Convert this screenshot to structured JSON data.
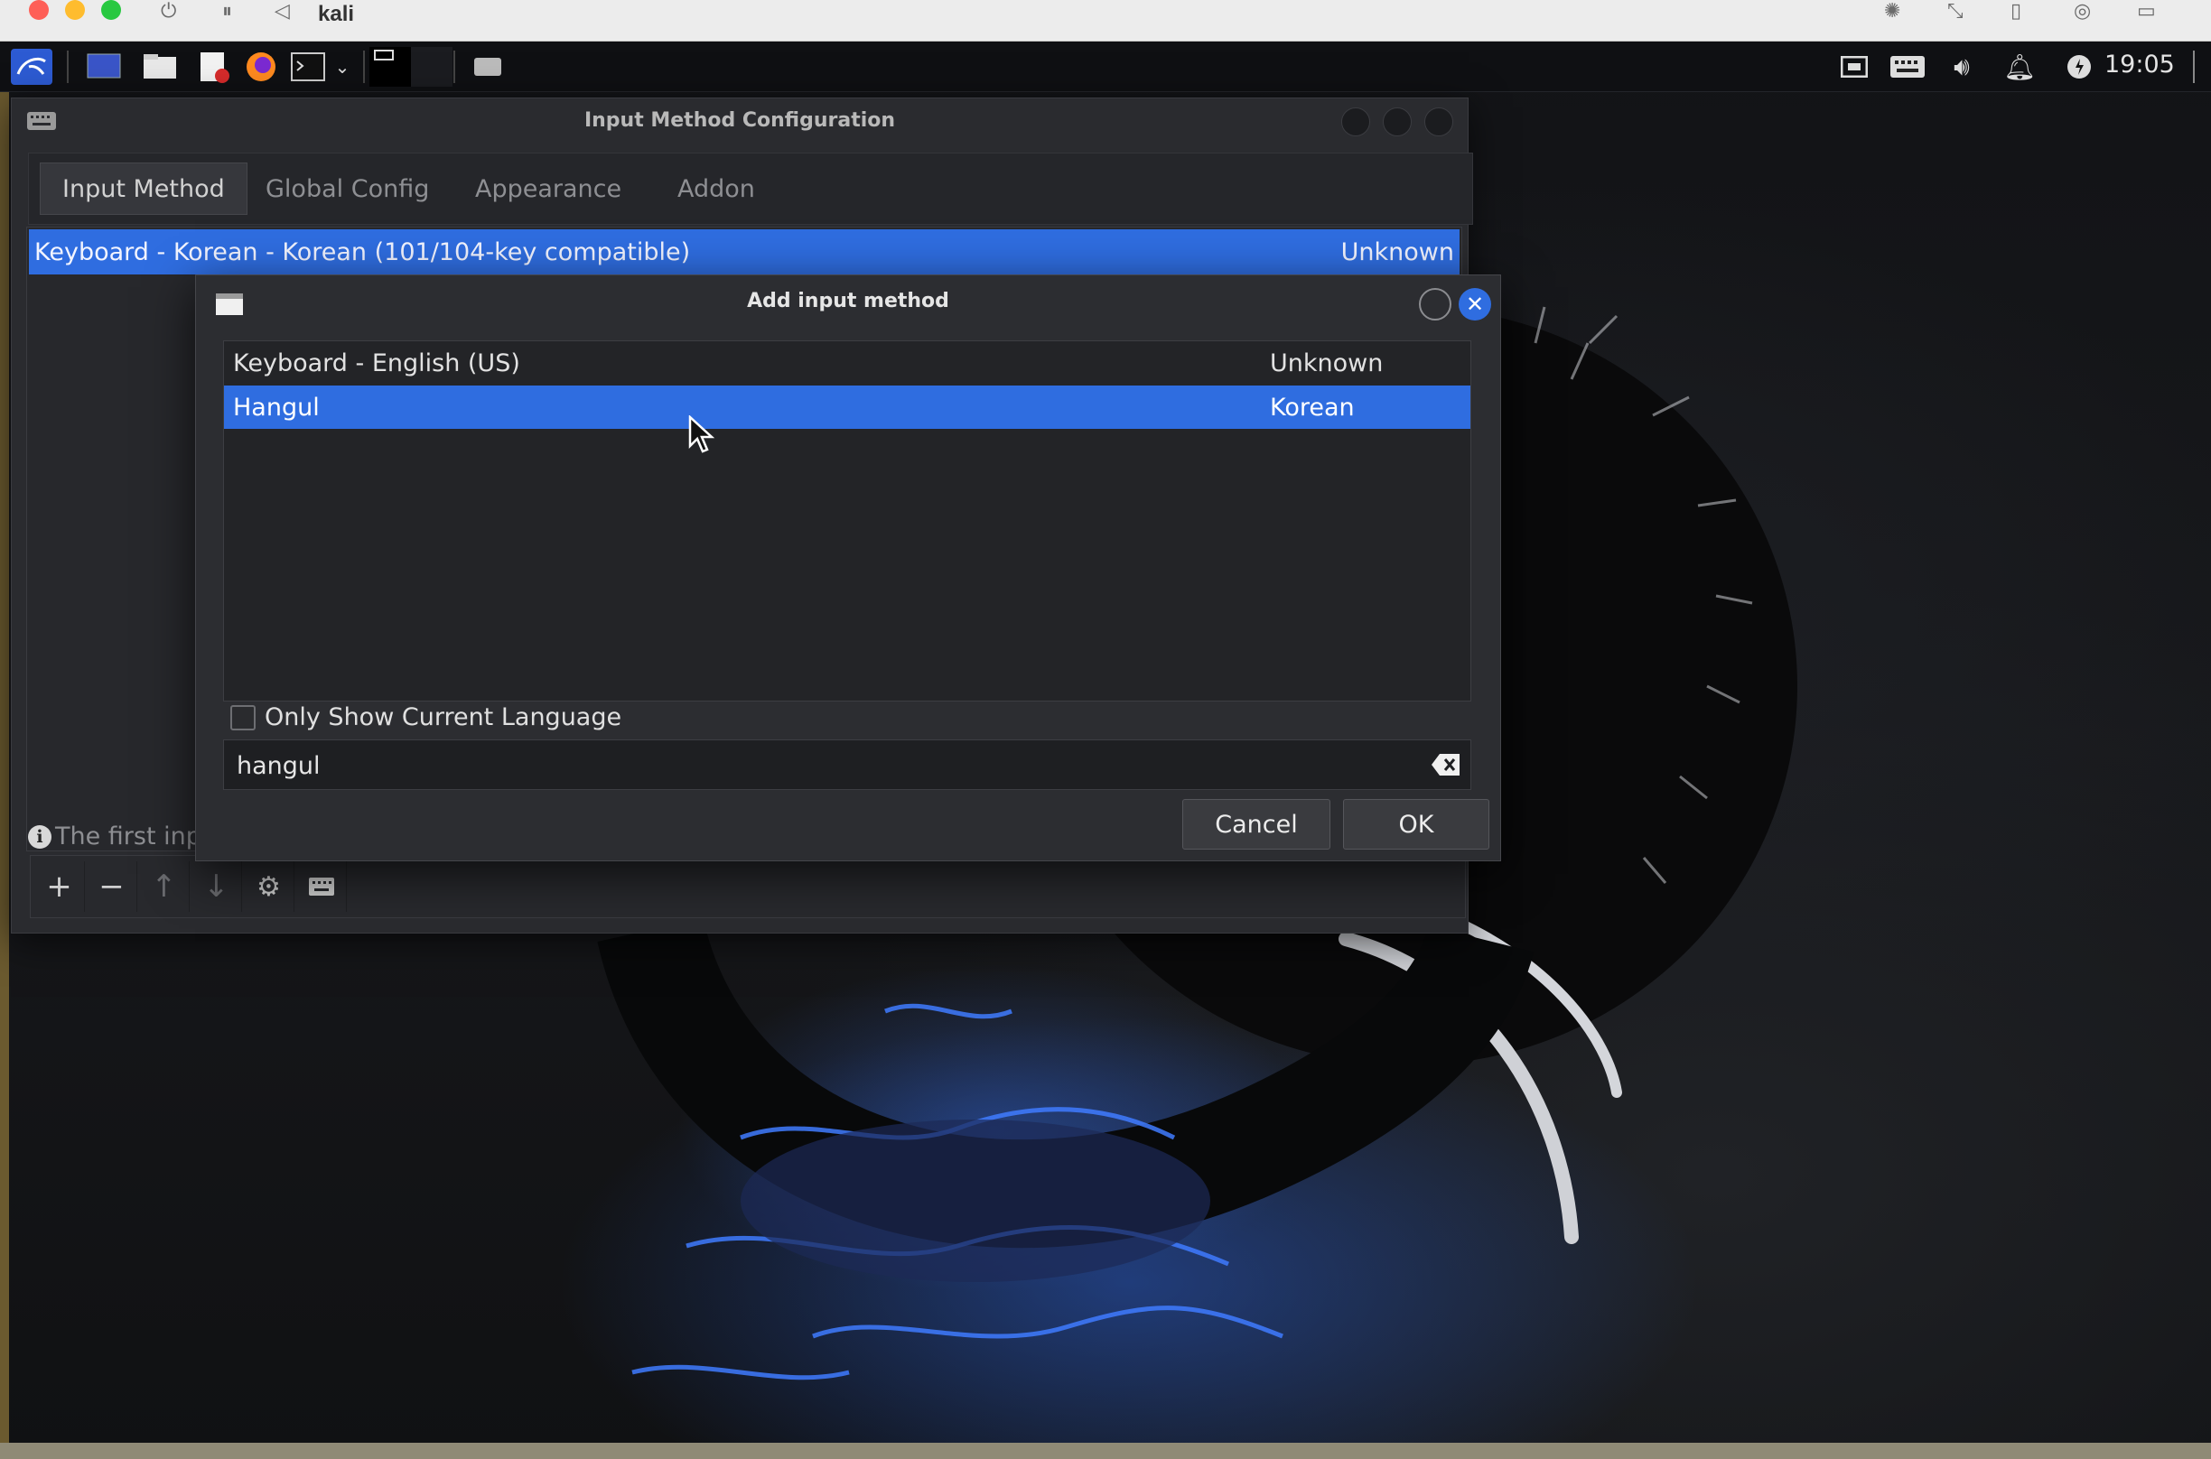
{
  "host": {
    "title": "kali",
    "traffic_colors": [
      "#fe5f57",
      "#febc2e",
      "#28c840"
    ],
    "icons": [
      "power-icon",
      "pause-icon",
      "back-icon",
      "brightness-icon",
      "resize-icon",
      "device-icon",
      "settings-icon",
      "window-icon"
    ]
  },
  "panel": {
    "clock": "19:05",
    "icons": [
      "kali-menu-icon",
      "desktop-icon",
      "file-manager-icon",
      "text-editor-icon",
      "firefox-icon",
      "terminal-icon",
      "keyboard-icon",
      "network-icon",
      "keyboard-layout-icon",
      "volume-icon",
      "bell-icon",
      "power-icon"
    ]
  },
  "config_window": {
    "title": "Input Method Configuration",
    "tabs": [
      {
        "label": "Input Method",
        "active": true
      },
      {
        "label": "Global Config",
        "active": false
      },
      {
        "label": "Appearance",
        "active": false
      },
      {
        "label": "Addon",
        "active": false
      }
    ],
    "methods": [
      {
        "name": "Keyboard - Korean - Korean (101/104-key compatible)",
        "language": "Unknown"
      }
    ],
    "info_text": "The first inpu",
    "toolbar": [
      "plus-icon",
      "minus-icon",
      "arrow-up-icon",
      "arrow-down-icon",
      "gear-icon",
      "keyboard-icon"
    ]
  },
  "dialog": {
    "title": "Add input method",
    "rows": [
      {
        "name": "Keyboard - English (US)",
        "language": "Unknown",
        "selected": false
      },
      {
        "name": "Hangul",
        "language": "Korean",
        "selected": true
      }
    ],
    "only_show_label": "Only Show Current Language",
    "only_show_checked": false,
    "search_value": "hangul",
    "cancel_label": "Cancel",
    "ok_label": "OK"
  },
  "colors": {
    "accent": "#2f6de0",
    "window_bg": "#2a2b2f"
  }
}
